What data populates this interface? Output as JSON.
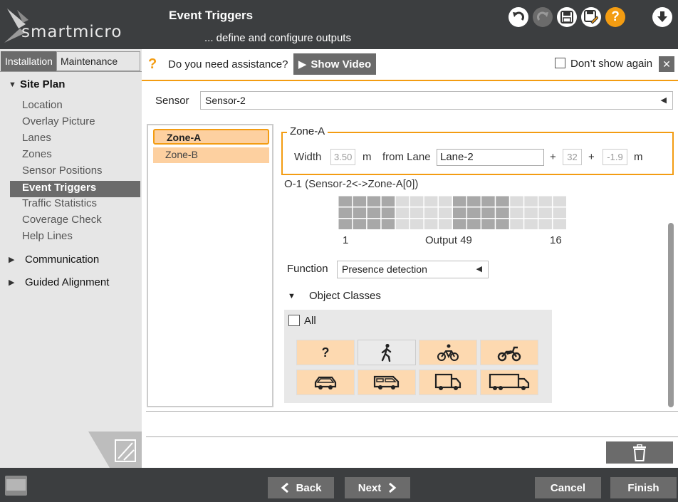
{
  "app": {
    "logo_text": "smartmicro",
    "title": "Event Triggers",
    "subtitle": "... define and configure outputs"
  },
  "header_icons": [
    "undo-icon",
    "redo-icon",
    "save-icon",
    "save-as-icon",
    "help-icon",
    "download-icon"
  ],
  "nav": {
    "tabs": [
      {
        "label": "Installation",
        "active": true
      },
      {
        "label": "Maintenance",
        "active": false
      }
    ],
    "sections": [
      {
        "label": "Site Plan",
        "expanded": true,
        "items": [
          {
            "label": "Location"
          },
          {
            "label": "Overlay Picture"
          },
          {
            "label": "Lanes"
          },
          {
            "label": "Zones"
          },
          {
            "label": "Sensor Positions"
          },
          {
            "label": "Event Triggers",
            "active": true
          },
          {
            "label": "Traffic Statistics"
          },
          {
            "label": "Coverage Check"
          },
          {
            "label": "Help Lines"
          }
        ]
      },
      {
        "label": "Communication",
        "expanded": false
      },
      {
        "label": "Guided Alignment",
        "expanded": false
      }
    ]
  },
  "assistance": {
    "icon": "?",
    "text": "Do you need assistance?",
    "show_video_label": "Show Video",
    "dont_show_label": "Don’t show again",
    "dont_show_checked": false,
    "close_label": "✕"
  },
  "sensor": {
    "label": "Sensor",
    "value": "Sensor-2"
  },
  "zones": [
    {
      "label": "Zone-A",
      "selected": true
    },
    {
      "label": "Zone-B",
      "selected": false
    }
  ],
  "zone_config": {
    "legend": "Zone-A",
    "width_label": "Width",
    "width_value": "3.50",
    "width_unit": "m",
    "from_lane_label": "from Lane",
    "lane_value": "Lane-2",
    "plus": "+",
    "offset1": "32",
    "offset2": "-1.9",
    "offset_unit": "m"
  },
  "output": {
    "title": "O-1 (Sensor-2<->Zone-A[0])",
    "label_start": "1",
    "label_mid": "Output 49",
    "label_end": "16",
    "grid_rows": 3,
    "grid_cols": 16,
    "active_columns": [
      1,
      2,
      3,
      4,
      9,
      10,
      11,
      12
    ]
  },
  "function": {
    "label": "Function",
    "value": "Presence detection"
  },
  "object_classes": {
    "label": "Object Classes",
    "all_label": "All",
    "all_checked": false,
    "items": [
      {
        "name": "unknown",
        "icon": "question-icon",
        "text": "?",
        "enabled": true
      },
      {
        "name": "pedestrian",
        "icon": "pedestrian-icon",
        "enabled": false
      },
      {
        "name": "bicycle",
        "icon": "bicycle-icon",
        "enabled": true
      },
      {
        "name": "motorcycle",
        "icon": "motorcycle-icon",
        "enabled": true
      },
      {
        "name": "car",
        "icon": "car-icon",
        "enabled": true
      },
      {
        "name": "van",
        "icon": "van-icon",
        "enabled": true
      },
      {
        "name": "truck",
        "icon": "truck-icon",
        "enabled": true
      },
      {
        "name": "long-truck",
        "icon": "long-truck-icon",
        "enabled": true
      }
    ]
  },
  "footer": {
    "back_label": "Back",
    "next_label": "Next",
    "cancel_label": "Cancel",
    "finish_label": "Finish"
  },
  "colors": {
    "header_bg": "#3c3e40",
    "accent": "#f39c12",
    "button_gray": "#6b6b6b",
    "zone_fill": "#fdd0a0",
    "grid_dark": "#a8a8a8",
    "grid_light": "#dcdcdc"
  }
}
